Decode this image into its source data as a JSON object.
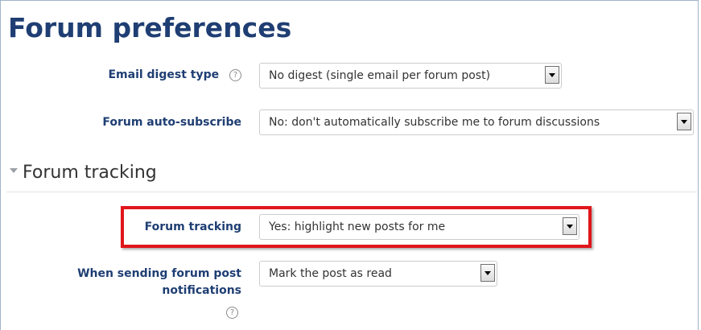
{
  "page": {
    "title": "Forum preferences"
  },
  "fields": {
    "email_digest": {
      "label": "Email digest type",
      "help_icon": "question-circle-icon",
      "value": "No digest (single email per forum post)"
    },
    "auto_subscribe": {
      "label": "Forum auto-subscribe",
      "value": "No: don't automatically subscribe me to forum discussions"
    },
    "forum_tracking": {
      "label": "Forum tracking",
      "value": "Yes: highlight new posts for me"
    },
    "mark_read": {
      "label_line1": "When sending forum post",
      "label_line2": "notifications",
      "help_icon": "question-circle-icon",
      "value": "Mark the post as read"
    }
  },
  "section": {
    "title": "Forum tracking",
    "caret_icon": "caret-down-icon"
  },
  "colors": {
    "heading": "#1f3e73",
    "highlight": "#e0161b"
  },
  "glyphs": {
    "help": "?"
  }
}
